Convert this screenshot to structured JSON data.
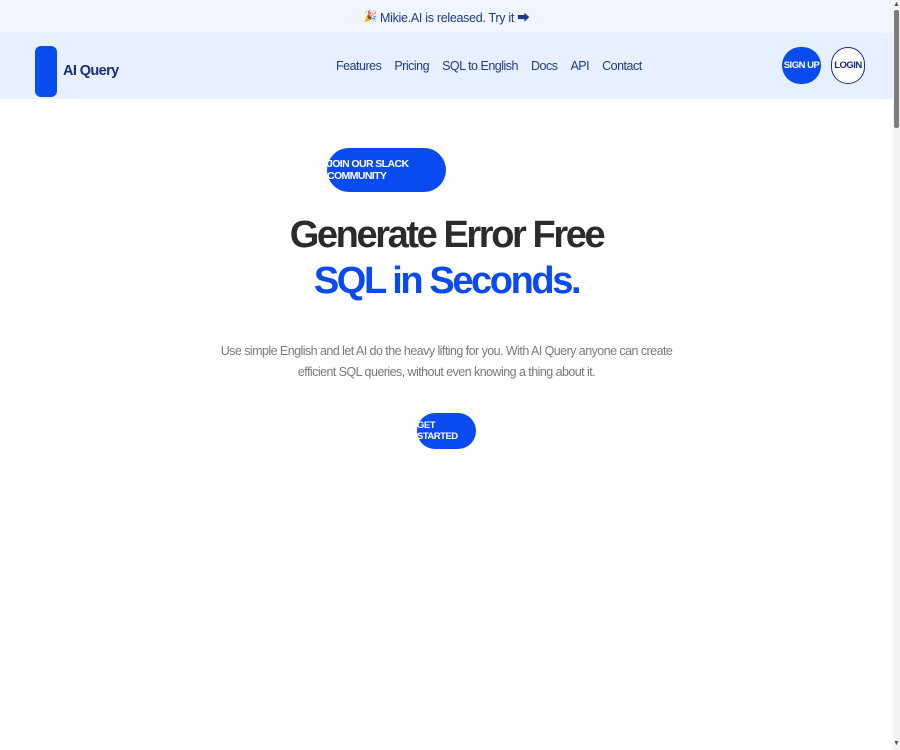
{
  "announcement": {
    "icon": "party-popper-icon",
    "text": "Mikie.AI is released. Try it ⮕"
  },
  "header": {
    "brand": "AI Query",
    "brand_color": "#0a4bf0",
    "nav": [
      {
        "label": "Features"
      },
      {
        "label": "Pricing"
      },
      {
        "label": "SQL to English"
      },
      {
        "label": "Docs"
      },
      {
        "label": "API"
      },
      {
        "label": "Contact"
      }
    ],
    "signup_label": "SIGN UP",
    "login_label": "LOGIN"
  },
  "hero": {
    "community_label": "JOIN OUR SLACK COMMUNITY",
    "title_line1": "Generate Error Free",
    "title_line2": "SQL in Seconds.",
    "subtitle": "Use simple English and let AI do the heavy lifting for you. With AI Query anyone can create efficient SQL queries, without even knowing a thing about it.",
    "cta_label": "GET STARTED"
  },
  "colors": {
    "accent": "#0a4bf0",
    "header_bg": "#e6f0fe",
    "announcement_bg": "#f0f5ff"
  }
}
